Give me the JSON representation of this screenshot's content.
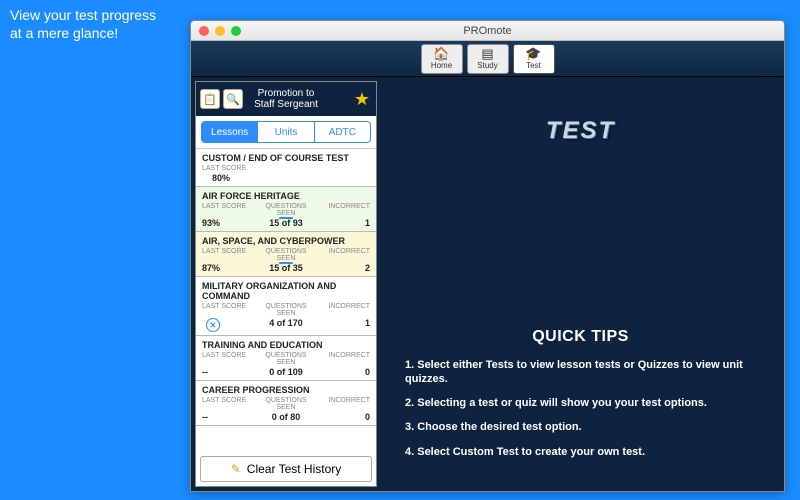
{
  "caption": {
    "line1": "View your test progress",
    "line2": "at a mere glance!"
  },
  "window_title": "PROmote",
  "toolbar": {
    "home": "Home",
    "study": "Study",
    "test": "Test"
  },
  "left": {
    "title_line1": "Promotion to",
    "title_line2": "Staff Sergeant",
    "tabs": {
      "lessons": "Lessons",
      "units": "Units",
      "adtc": "ADTC"
    },
    "cols": {
      "last": "LAST SCORE",
      "seen": "QUESTIONS SEEN",
      "incorrect": "INCORRECT"
    },
    "rows": [
      {
        "title": "CUSTOM / END OF COURSE TEST",
        "single": true,
        "last": "80%"
      },
      {
        "title": "AIR FORCE HERITAGE",
        "hl": "green",
        "last": "93%",
        "seen": "15 of 93",
        "incorrect": "1"
      },
      {
        "title": "AIR, SPACE, AND CYBERPOWER",
        "hl": "yellow",
        "last": "87%",
        "seen": "15 of 35",
        "incorrect": "2"
      },
      {
        "title": "MILITARY ORGANIZATION AND COMMAND",
        "badge": true,
        "last": "",
        "seen": "4 of 170",
        "incorrect": "1"
      },
      {
        "title": "TRAINING AND EDUCATION",
        "last": "--",
        "seen": "0 of 109",
        "incorrect": "0"
      },
      {
        "title": "CAREER PROGRESSION",
        "last": "--",
        "seen": "0 of 80",
        "incorrect": "0"
      }
    ],
    "clear": "Clear Test History"
  },
  "right": {
    "logo": "TEST",
    "quick_tips_heading": "QUICK TIPS",
    "tips": [
      "1. Select either Tests to view lesson tests or Quizzes to view unit quizzes.",
      "2. Selecting a test or quiz will show you your test options.",
      "3. Choose the desired test option.",
      "4. Select Custom Test to create your own test."
    ]
  }
}
